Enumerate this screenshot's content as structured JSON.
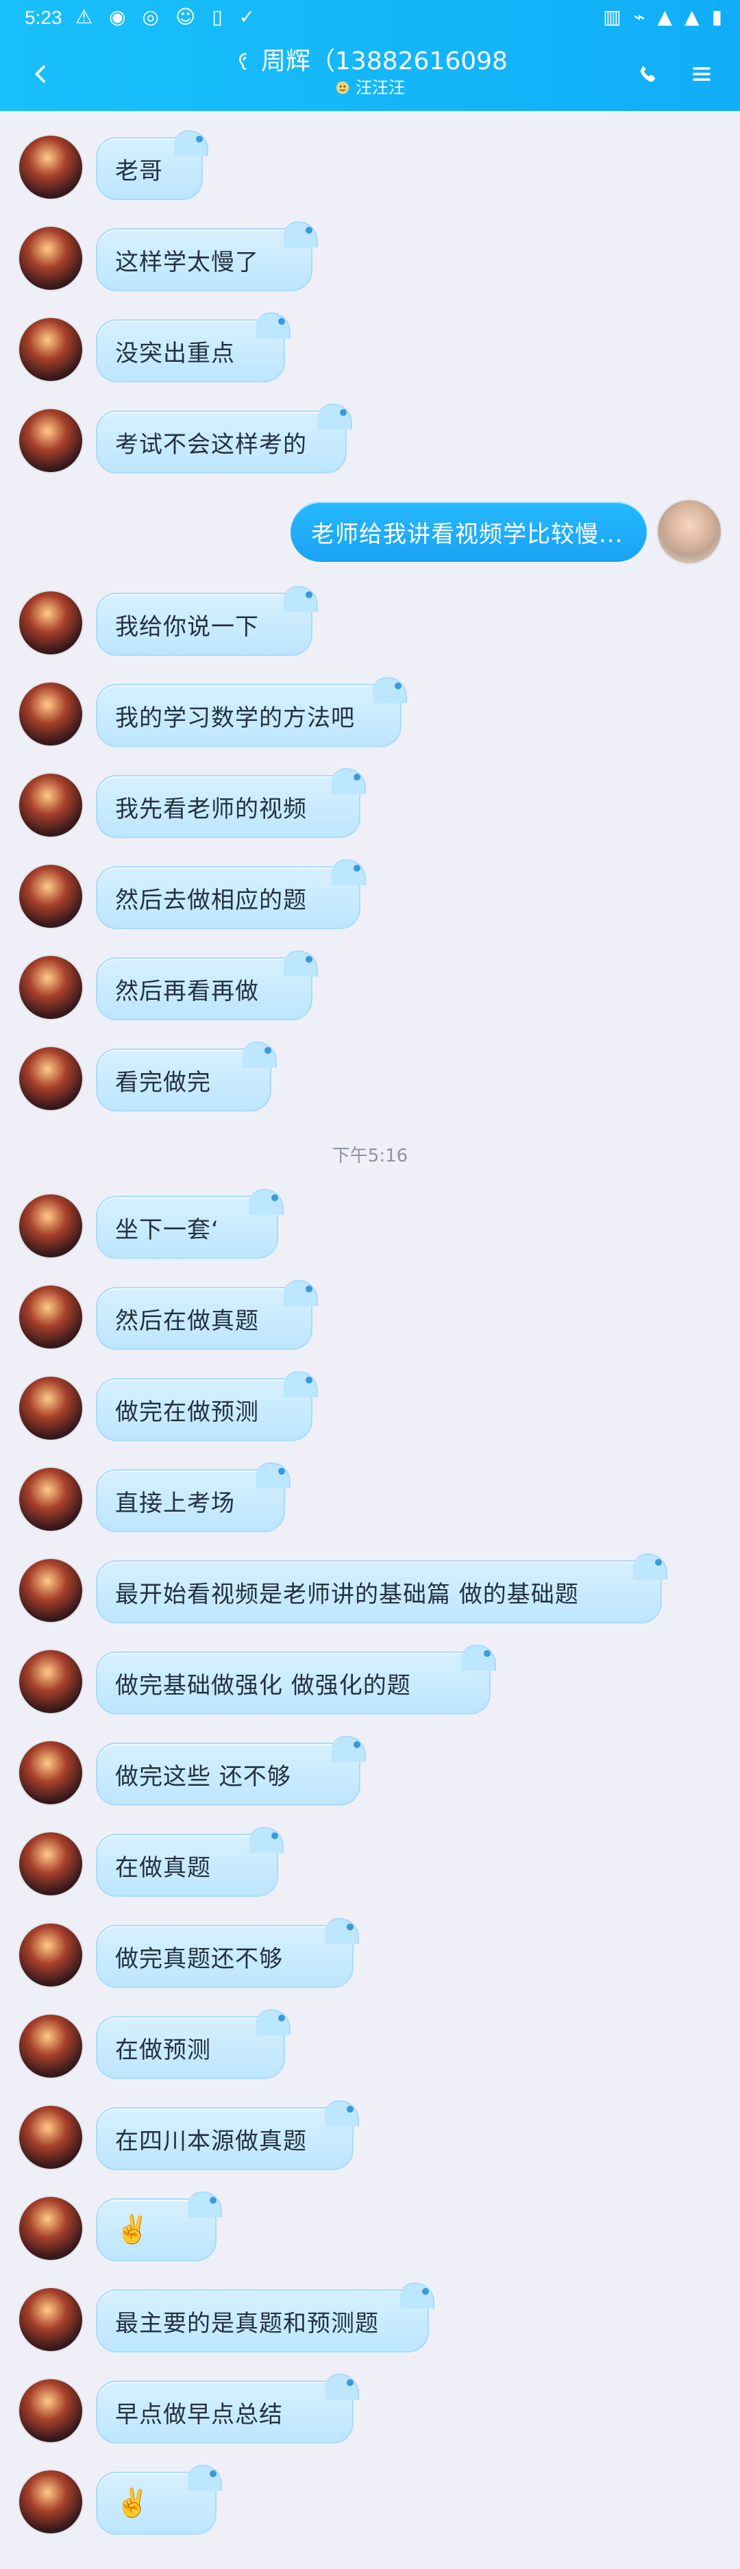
{
  "status_bar": {
    "time": "5:23",
    "left_icons": [
      "warning-icon",
      "circle-icon",
      "target-icon",
      "smile-icon",
      "sim-icon",
      "check-icon"
    ],
    "right_icons": [
      "vibrate-icon",
      "wifi-icon",
      "signal-icon",
      "signal-icon",
      "battery-icon"
    ]
  },
  "header": {
    "title": "周辉（13882616098",
    "subtitle": "汪汪汪",
    "colors": {
      "bg_start": "#19c0fb",
      "bg_end": "#10aef7"
    }
  },
  "chat": {
    "messages_top": [
      {
        "side": "in",
        "text": "老哥"
      },
      {
        "side": "in",
        "text": "这样学太慢了"
      },
      {
        "side": "in",
        "text": "没突出重点"
      },
      {
        "side": "in",
        "text": "考试不会这样考的"
      },
      {
        "side": "out",
        "text": "老师给我讲看视频学比较慢..."
      },
      {
        "side": "in",
        "text": "我给你说一下"
      },
      {
        "side": "in",
        "text": "我的学习数学的方法吧"
      },
      {
        "side": "in",
        "text": "我先看老师的视频"
      },
      {
        "side": "in",
        "text": "然后去做相应的题"
      },
      {
        "side": "in",
        "text": "然后再看再做"
      },
      {
        "side": "in",
        "text": "看完做完"
      }
    ],
    "divider": "下午5:16",
    "messages_bottom": [
      {
        "side": "in",
        "text": "坐下一套‘"
      },
      {
        "side": "in",
        "text": "然后在做真题"
      },
      {
        "side": "in",
        "text": "做完在做预测"
      },
      {
        "side": "in",
        "text": "直接上考场"
      },
      {
        "side": "in",
        "text": "最开始看视频是老师讲的基础篇  做的基础题"
      },
      {
        "side": "in",
        "text": "做完基础做强化  做强化的题"
      },
      {
        "side": "in",
        "text": "做完这些  还不够"
      },
      {
        "side": "in",
        "text": "在做真题"
      },
      {
        "side": "in",
        "text": "做完真题还不够"
      },
      {
        "side": "in",
        "text": "在做预测"
      },
      {
        "side": "in",
        "text": "在四川本源做真题"
      },
      {
        "side": "in",
        "text": "✌️"
      },
      {
        "side": "in",
        "text": "最主要的是真题和预测题"
      },
      {
        "side": "in",
        "text": "早点做早点总结"
      },
      {
        "side": "in",
        "text": "✌️"
      }
    ]
  }
}
